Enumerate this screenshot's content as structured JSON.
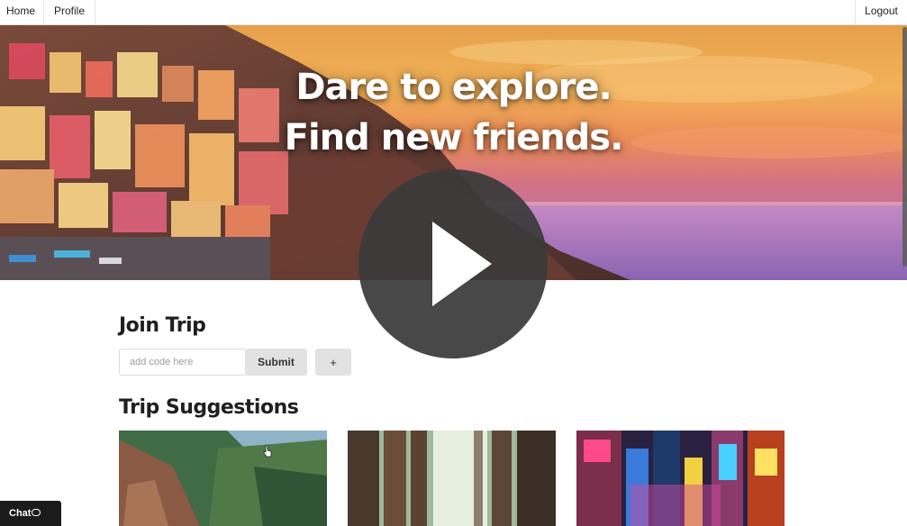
{
  "nav": {
    "home_label": "Home",
    "profile_label": "Profile",
    "logout_label": "Logout"
  },
  "hero": {
    "line1": "Dare to explore.",
    "line2": "Find new friends."
  },
  "join_trip": {
    "title": "Join Trip",
    "code_placeholder": "add code here",
    "submit_label": "Submit",
    "add_label": "+"
  },
  "suggestions": {
    "title": "Trip Suggestions",
    "cards": [
      {
        "image": "coastal-cliffs-photo"
      },
      {
        "image": "redwood-forest-photo"
      },
      {
        "image": "neon-city-street-photo"
      }
    ]
  },
  "chat": {
    "label": "Chat"
  },
  "video_overlay": {
    "icon": "play-icon"
  },
  "colors": {
    "nav_border": "#e4e4e4",
    "button_bg": "#e2e2e2",
    "chat_bg": "#1b1b1b",
    "play_bg": "#3a3a3a"
  }
}
